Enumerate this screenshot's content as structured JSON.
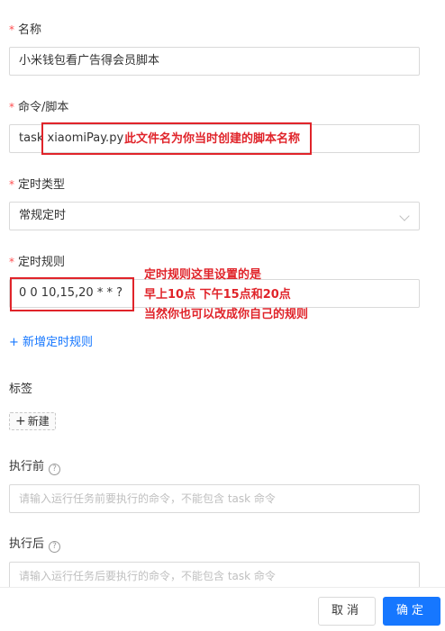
{
  "fields": {
    "name": {
      "label": "名称",
      "value": "小米钱包看广告得会员脚本"
    },
    "command": {
      "label": "命令/脚本",
      "value": "task xiaomiPay.py"
    },
    "schedule_type": {
      "label": "定时类型",
      "value": "常规定时"
    },
    "schedule_rule": {
      "label": "定时规则",
      "value": "0 0 10,15,20 * * ?"
    },
    "add_rule_link": "+ 新增定时规则",
    "tags": {
      "label": "标签",
      "new_button": "新建"
    },
    "before": {
      "label": "执行前",
      "placeholder": "请输入运行任务前要执行的命令，不能包含 task 命令"
    },
    "after": {
      "label": "执行后",
      "placeholder": "请输入运行任务后要执行的命令，不能包含 task 命令"
    }
  },
  "annotations": {
    "filename_note": "此文件名为你当时创建的脚本名称",
    "rule_note_line1": "定时规则这里设置的是",
    "rule_note_line2": "早上10点 下午15点和20点",
    "rule_note_line3": "当然你也可以改成你自己的规则"
  },
  "footer": {
    "cancel": "取消",
    "ok": "确定"
  },
  "colors": {
    "required": "#ff4d4f",
    "primary": "#1677ff",
    "annotation": "#e0242a"
  }
}
